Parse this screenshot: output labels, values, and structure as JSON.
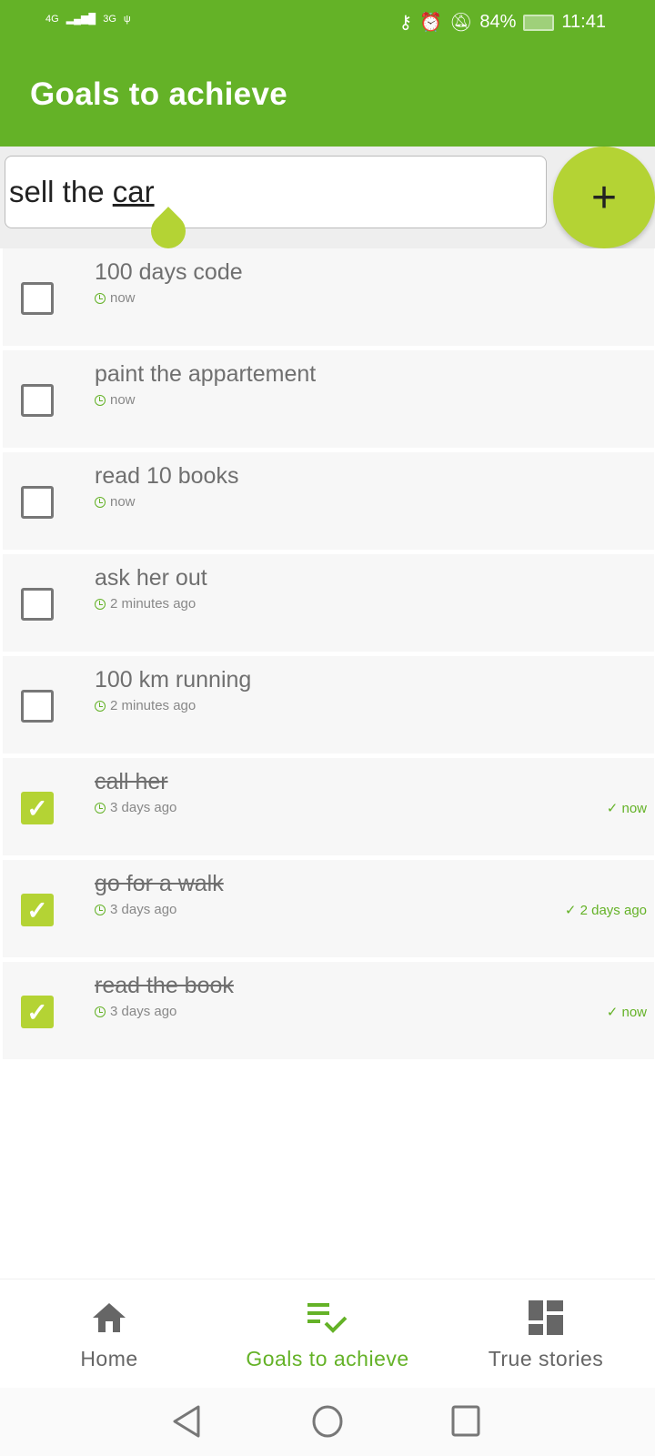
{
  "status_bar": {
    "network1": "4G",
    "network2": "3G",
    "battery": "84%",
    "time": "11:41"
  },
  "app_bar": {
    "title": "Goals to achieve"
  },
  "input": {
    "value_prefix": "sell the ",
    "value_word": "car"
  },
  "add_button": {
    "label": "+"
  },
  "goals": [
    {
      "title": "100 days code",
      "created": "now",
      "done": false
    },
    {
      "title": "paint the appartement",
      "created": "now",
      "done": false
    },
    {
      "title": "read 10 books",
      "created": "now",
      "done": false
    },
    {
      "title": "ask her out",
      "created": "2 minutes ago",
      "done": false
    },
    {
      "title": "100 km running",
      "created": "2 minutes ago",
      "done": false
    },
    {
      "title": "call her",
      "created": "3 days ago",
      "done": true,
      "completed": "✓ now"
    },
    {
      "title": "go for a walk",
      "created": "3 days ago",
      "done": true,
      "completed": "✓ 2 days ago"
    },
    {
      "title": "read the book",
      "created": "3 days ago",
      "done": true,
      "completed": "✓ now"
    }
  ],
  "bottom_nav": [
    {
      "label": "Home",
      "icon": "home-icon"
    },
    {
      "label": "Goals to achieve",
      "icon": "checklist-icon",
      "active": true
    },
    {
      "label": "True stories",
      "icon": "dashboard-icon"
    }
  ],
  "colors": {
    "primary": "#64b227",
    "accent": "#b4d334"
  }
}
